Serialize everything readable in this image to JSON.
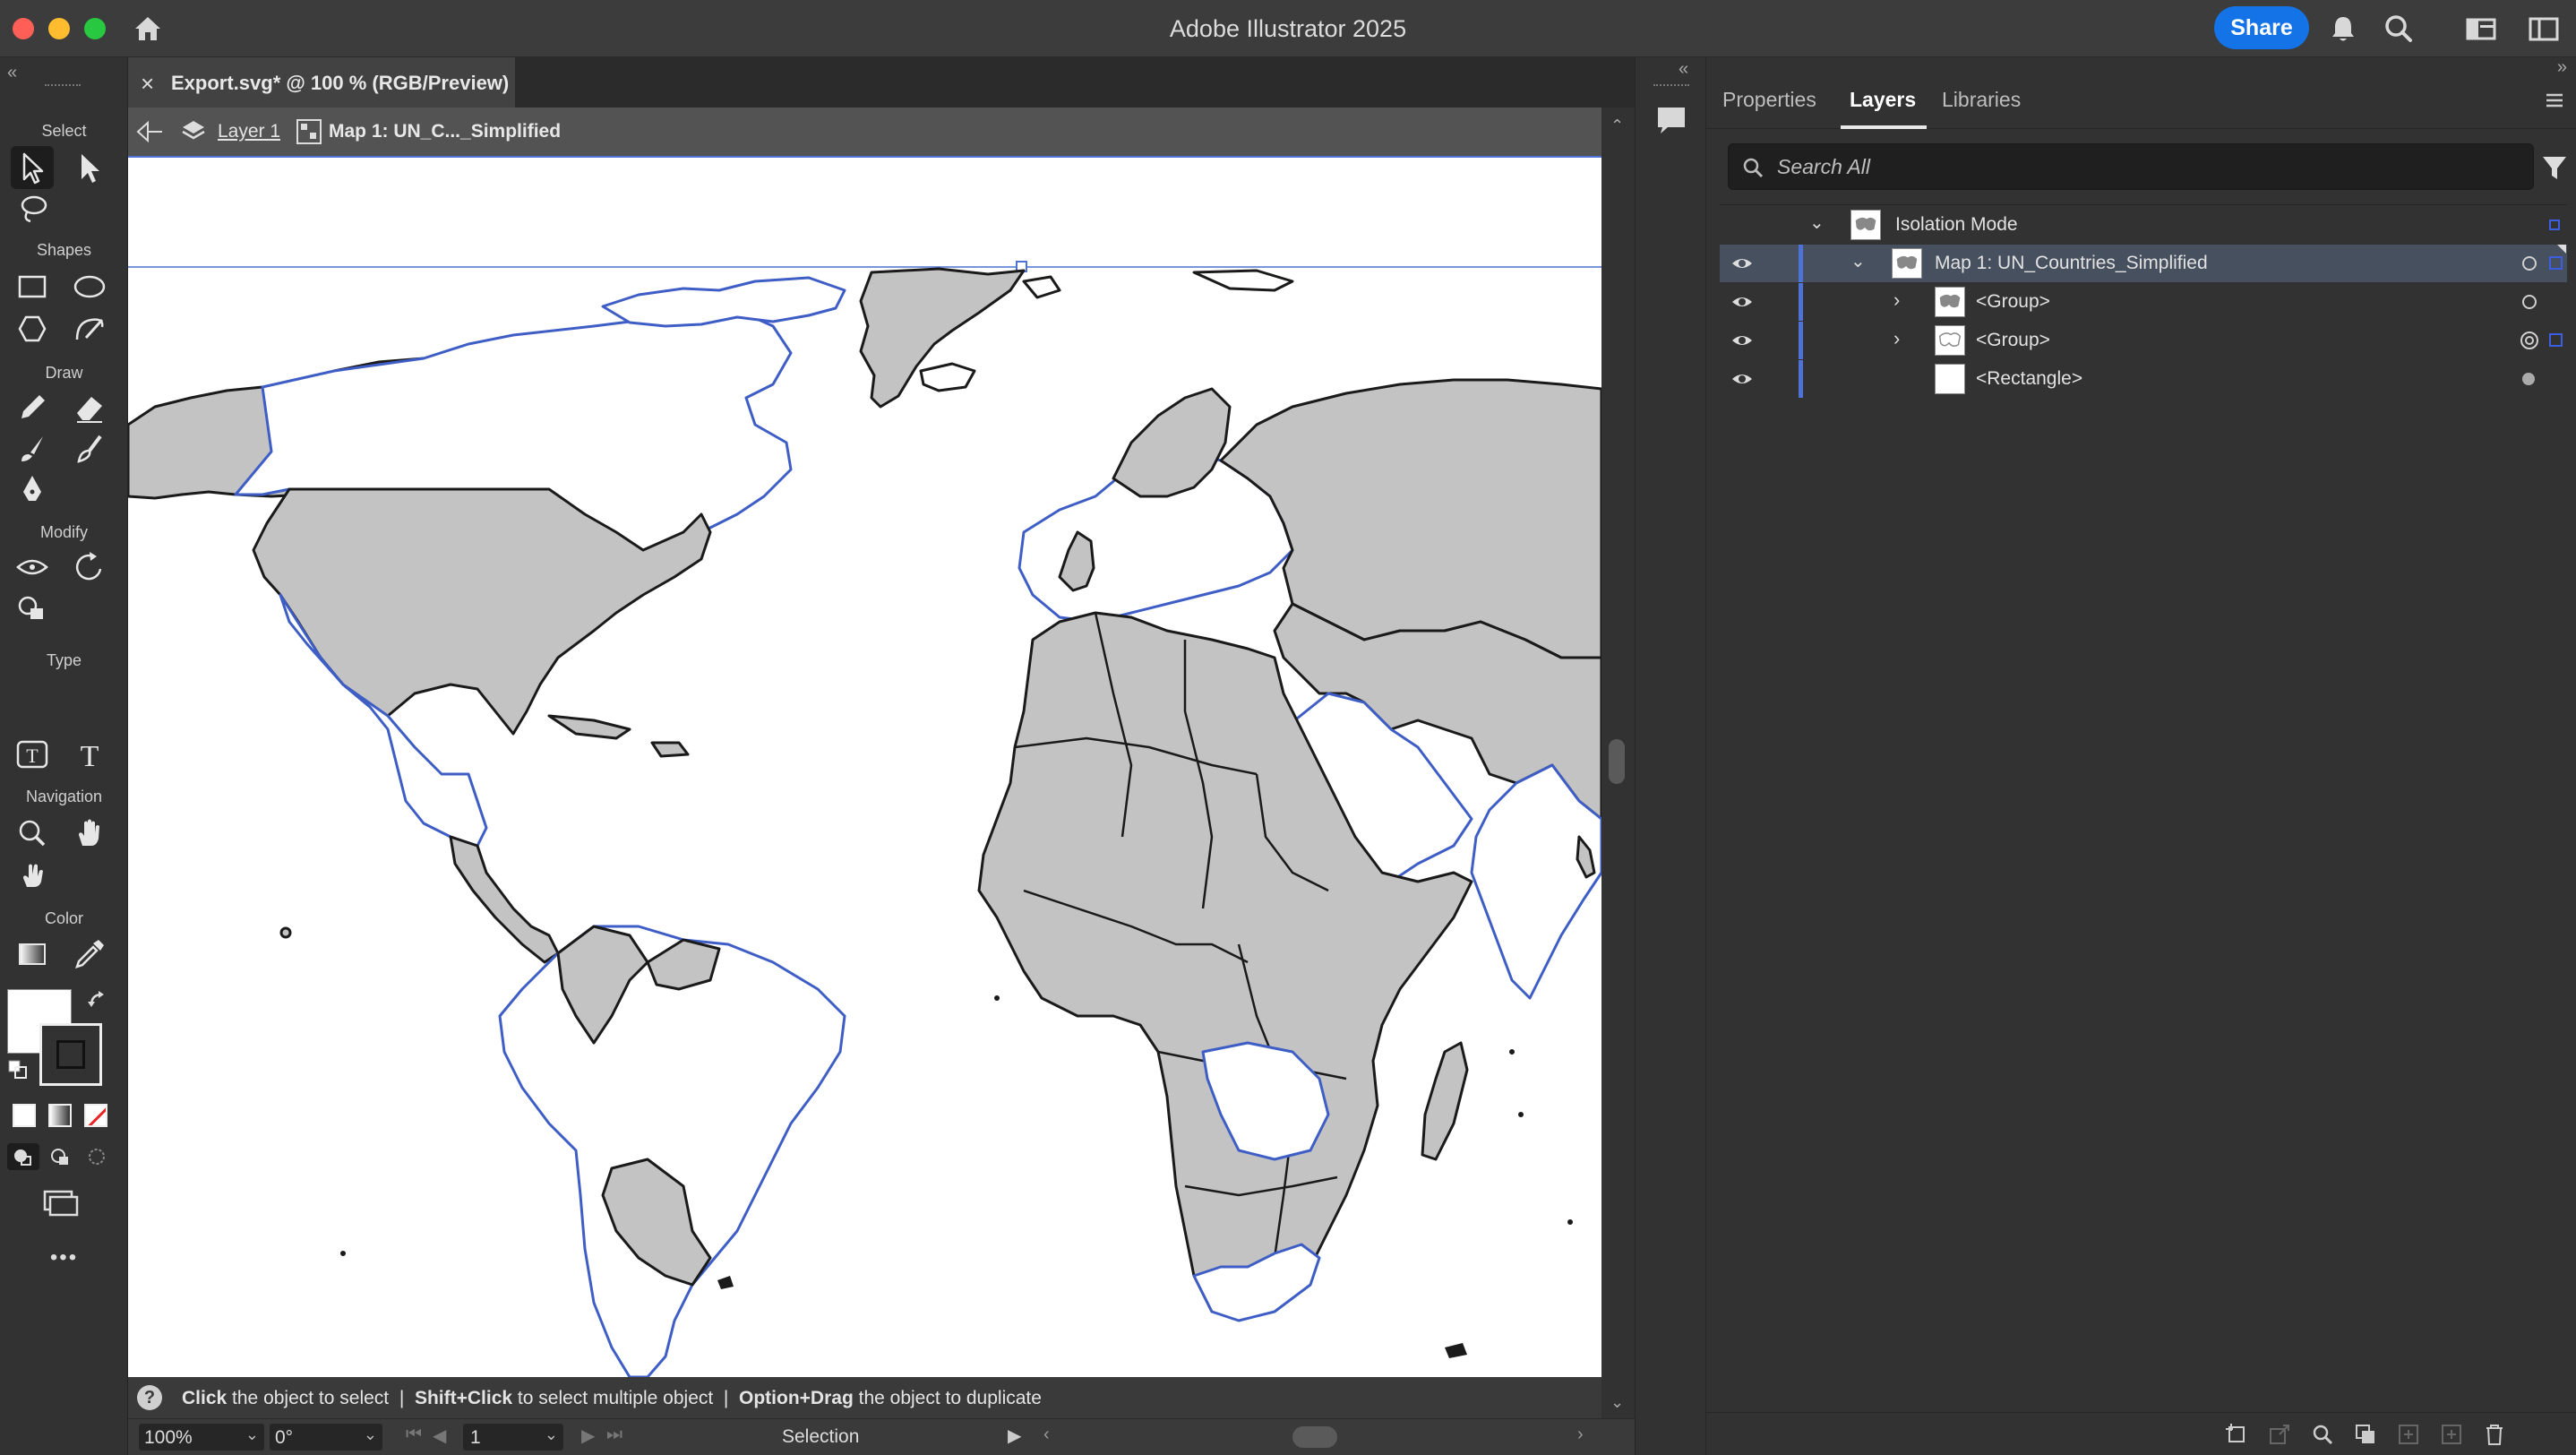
{
  "window": {
    "title": "Adobe Illustrator 2025",
    "share_label": "Share"
  },
  "colors": {
    "accent": "#1473e6",
    "selection": "#4f72d6",
    "landfill": "#c3c3c3",
    "canvas": "#ffffff"
  },
  "toolbar": {
    "sections": [
      "Select",
      "Shapes",
      "Draw",
      "Modify",
      "Type",
      "Navigation",
      "Color"
    ],
    "more_label": "•••"
  },
  "document": {
    "tab_title": "Export.svg* @ 100 % (RGB/Preview)",
    "breadcrumb_layer": "Layer 1",
    "breadcrumb_object": "Map 1: UN_C..._Simplified"
  },
  "status": {
    "hint_parts": [
      {
        "b": "Click",
        "t": " the object to select"
      },
      {
        "b": "Shift+Click",
        "t": " to select multiple object"
      },
      {
        "b": "Option+Drag",
        "t": " the object to duplicate"
      }
    ],
    "separator": "|",
    "zoom": "100%",
    "rotation": "0°",
    "artboard": "1",
    "tool_name": "Selection"
  },
  "panel": {
    "tabs": [
      "Properties",
      "Layers",
      "Libraries"
    ],
    "active_tab": "Layers",
    "search_placeholder": "Search All",
    "layers": [
      {
        "label": "Isolation Mode",
        "indent": 0,
        "expanded": true,
        "visible": false,
        "selected": false,
        "kind": "map"
      },
      {
        "label": "Map 1: UN_Countries_Simplified",
        "indent": 1,
        "expanded": true,
        "visible": true,
        "selected": true,
        "kind": "map"
      },
      {
        "label": "<Group>",
        "indent": 2,
        "expanded": false,
        "visible": true,
        "selected": false,
        "kind": "map"
      },
      {
        "label": "<Group>",
        "indent": 2,
        "expanded": false,
        "visible": true,
        "selected": false,
        "kind": "map-light"
      },
      {
        "label": "<Rectangle>",
        "indent": 2,
        "expanded": null,
        "visible": true,
        "selected": false,
        "kind": "rect"
      }
    ]
  }
}
